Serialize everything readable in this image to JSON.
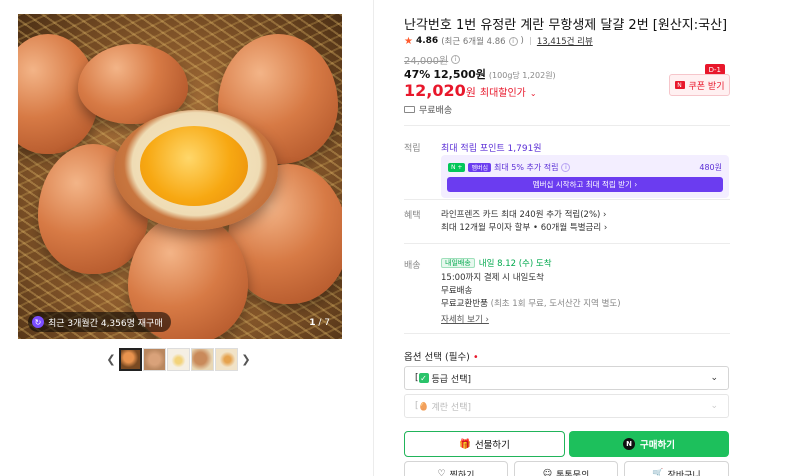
{
  "gallery": {
    "badge_text": "최근 3개월간 4,356명 재구매",
    "badge_icon": "repurchase-icon",
    "page_current": "1",
    "page_total": "/ 7",
    "prev_icon": "chevron-left-icon",
    "next_icon": "chevron-right-icon",
    "thumbnails": [
      "egg-thumb-1",
      "egg-thumb-2",
      "egg-thumb-3",
      "egg-thumb-4",
      "egg-thumb-5"
    ]
  },
  "product": {
    "title": "난각번호 1번 유정란 계란 무항생제 달걀 2번 [원산지:국산]",
    "rating": "4.86",
    "rating_recent": "(최근 6개월 4.86",
    "rating_recent_close": ")",
    "reviews": "13,415건 리뷰",
    "original_price": "24,000원",
    "discount_pct": "47%",
    "sale_price": "12,500원",
    "unit_price": "(100g당 1,202원)",
    "max_discount_price": "12,020",
    "max_discount_unit": "원",
    "max_discount_label": "최대할인가",
    "coupon_label": "쿠폰 받기",
    "coupon_dday": "D-1",
    "shipping": "무료배송"
  },
  "points": {
    "label": "적립",
    "max_points": "최대 적립 포인트 1,791원",
    "badge_n": "N +",
    "badge_plus": "멤버십",
    "extra_text": "최대 5% 추가 적립",
    "extra_amount": "480원",
    "membership_button": "멤버십 시작하고 최대 적립 받기 ›"
  },
  "benefits": {
    "label": "혜택",
    "card": "라인프렌즈 카드 최대 240원 추가 적립(2%) ›",
    "installment": "최대 12개월 무이자 할부 • 60개월 특별금리 ›"
  },
  "delivery": {
    "label": "배송",
    "badge": "내일배송",
    "eta": "내일 8.12 (수) 도착",
    "cutoff": "15:00까지 결제 시 내일도착",
    "fee": "무료배송",
    "exchange": "무료교환반품",
    "exchange_note": "(최초 1회 무료, 도서산간 지역 별도)",
    "more": "자세히 보기 ›"
  },
  "options": {
    "title": "옵션 선택 (필수)",
    "required_mark": "•",
    "select1": "등급 선택]",
    "select1_prefix": "[",
    "select2": "계란 선택]",
    "select2_prefix": "[",
    "caret": "⌄"
  },
  "actions": {
    "gift": "선물하기",
    "buy": "구매하기",
    "wish": "찜하기",
    "talk": "톡톡문의",
    "cart": "장바구니"
  },
  "colors": {
    "accent_red": "#e8172b",
    "naver_green": "#1dc05c",
    "membership_purple": "#6b3cf0"
  }
}
